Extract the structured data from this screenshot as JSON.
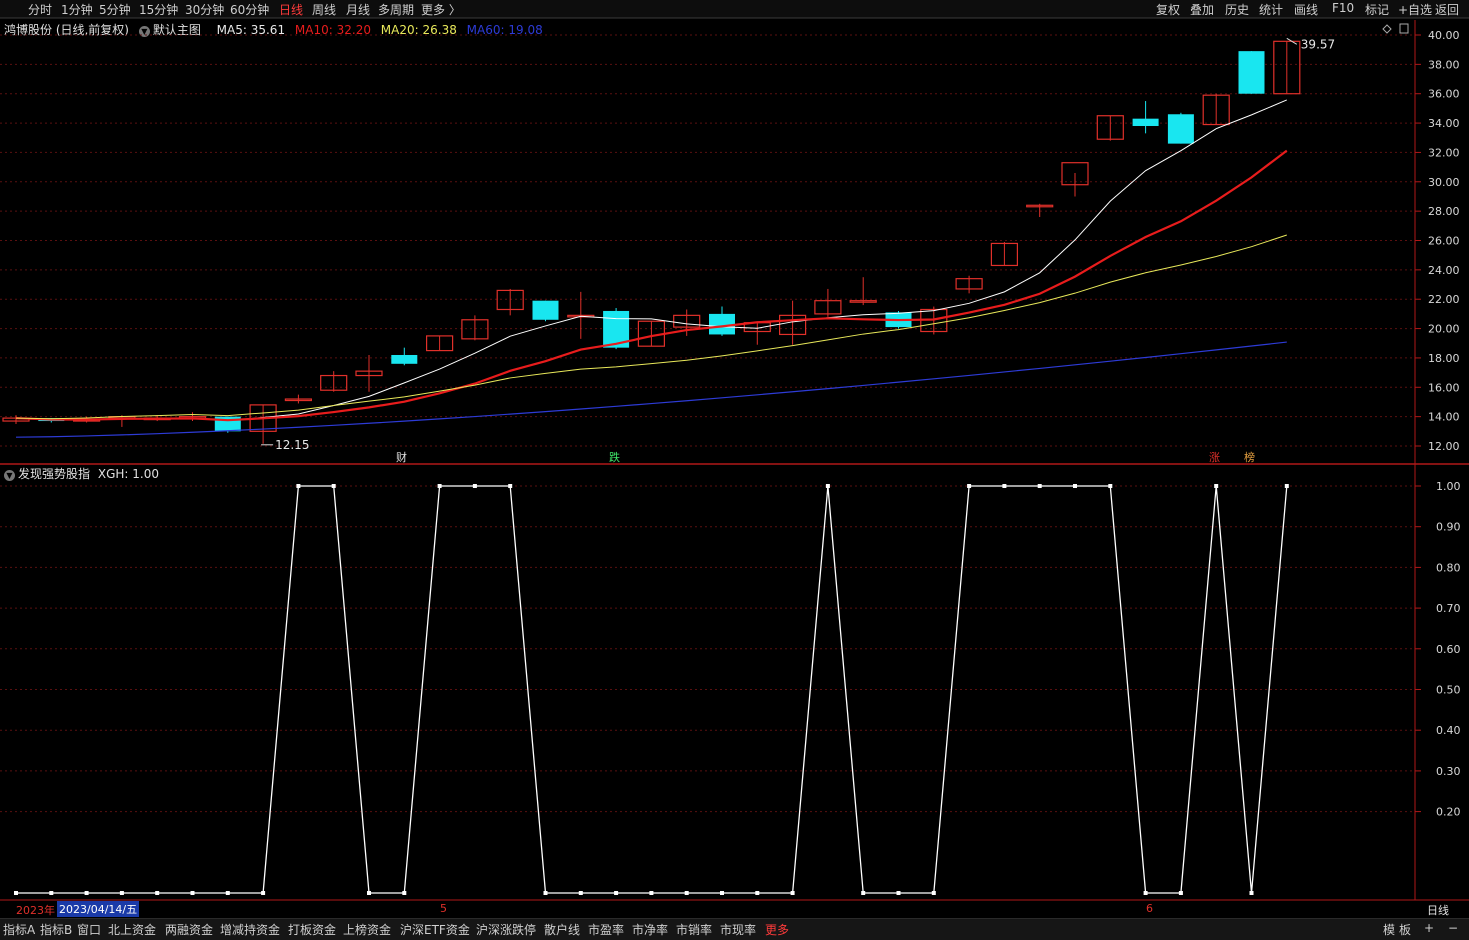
{
  "toolbar": {
    "left_items": [
      "分时",
      "1分钟",
      "5分钟",
      "15分钟",
      "30分钟",
      "60分钟",
      "日线",
      "周线",
      "月线",
      "多周期",
      "更多 〉"
    ],
    "active": "日线",
    "right_items": [
      "复权",
      "叠加",
      "历史",
      "统计",
      "画线",
      "F10",
      "标记",
      "+自选",
      "返回"
    ]
  },
  "main": {
    "stock": "鸿博股份 (日线,前复权)",
    "theme": "默认主图",
    "ma5": "MA5: 35.61",
    "ma10": "MA10: 32.20",
    "ma20": "MA20: 26.38",
    "ma60": "MA60: 19.08",
    "high_label": "39.57",
    "low_label": "12.15",
    "markers": [
      "财",
      "跌",
      "涨",
      "榜"
    ],
    "yticks": [
      "40.00",
      "38.00",
      "36.00",
      "34.00",
      "32.00",
      "30.00",
      "28.00",
      "26.00",
      "24.00",
      "22.00",
      "20.00",
      "18.00",
      "16.00",
      "14.00",
      "12.00"
    ],
    "colors": {
      "up": "#e0302a",
      "down": "#19e6f0",
      "ma5": "#ffffff",
      "ma10": "#e81c1c",
      "ma20": "#e8e85a",
      "ma60": "#2d3bd6",
      "grid": "#5a1010"
    }
  },
  "indicator": {
    "title": "发现强势股指",
    "value": "XGH: 1.00",
    "yticks": [
      "1.00",
      "0.90",
      "0.80",
      "0.70",
      "0.60",
      "0.50",
      "0.40",
      "0.30",
      "0.20"
    ]
  },
  "xaxis": {
    "year": "2023年",
    "cursor_date": "2023/04/14/五",
    "m5": "5",
    "m6": "6",
    "period": "日线"
  },
  "tabs": [
    "指标A",
    "指标B",
    "窗口",
    "北上资金",
    "两融资金",
    "增减持资金",
    "打板资金",
    "上榜资金",
    "沪深ETF资金",
    "沪深涨跌停",
    "散户线",
    "市盈率",
    "市净率",
    "市销率",
    "市现率",
    "更多"
  ],
  "right_controls": [
    "模",
    "板",
    "+",
    "−"
  ],
  "chart_data": {
    "type": "candlestick",
    "ohlc": [
      [
        13.7,
        14.1,
        13.5,
        13.9
      ],
      [
        13.9,
        13.9,
        13.6,
        13.7
      ],
      [
        13.8,
        14.0,
        13.6,
        13.8
      ],
      [
        13.9,
        14.1,
        13.3,
        14.0
      ],
      [
        13.8,
        14.1,
        13.7,
        13.9
      ],
      [
        13.9,
        14.3,
        13.7,
        14.0
      ],
      [
        14.0,
        14.0,
        12.9,
        13.0
      ],
      [
        13.0,
        14.8,
        12.15,
        14.8
      ],
      [
        15.1,
        15.5,
        14.9,
        15.2
      ],
      [
        15.8,
        17.1,
        15.7,
        16.8
      ],
      [
        16.8,
        18.2,
        15.7,
        17.1
      ],
      [
        18.2,
        18.7,
        17.5,
        17.6
      ],
      [
        18.5,
        19.5,
        18.5,
        19.5
      ],
      [
        19.3,
        20.9,
        19.2,
        20.6
      ],
      [
        21.3,
        22.7,
        20.9,
        22.6
      ],
      [
        21.9,
        21.9,
        20.5,
        20.6
      ],
      [
        20.9,
        22.5,
        19.3,
        20.9
      ],
      [
        21.2,
        21.4,
        18.6,
        18.7
      ],
      [
        18.8,
        20.5,
        18.8,
        20.5
      ],
      [
        20.1,
        21.3,
        19.5,
        20.9
      ],
      [
        21.0,
        21.5,
        19.5,
        19.6
      ],
      [
        19.8,
        20.4,
        18.9,
        20.4
      ],
      [
        19.6,
        21.9,
        18.9,
        20.9
      ],
      [
        21.0,
        22.7,
        20.8,
        21.9
      ],
      [
        21.9,
        23.5,
        21.6,
        21.9
      ],
      [
        21.1,
        21.2,
        20.0,
        20.1
      ],
      [
        19.8,
        21.5,
        19.6,
        21.3
      ],
      [
        22.7,
        23.6,
        22.4,
        23.4
      ],
      [
        24.3,
        25.9,
        24.3,
        25.8
      ],
      [
        28.3,
        28.5,
        27.6,
        28.4
      ],
      [
        29.8,
        30.6,
        29.0,
        31.3
      ],
      [
        32.9,
        34.5,
        32.8,
        34.5
      ],
      [
        34.3,
        35.5,
        33.3,
        33.8
      ],
      [
        34.6,
        34.7,
        32.6,
        32.6
      ],
      [
        33.9,
        36.0,
        33.9,
        35.9
      ],
      [
        38.9,
        38.9,
        36.0,
        36.0
      ],
      [
        36.0,
        39.57,
        36.0,
        39.57
      ]
    ],
    "indicator": "XGH",
    "xgh": [
      0,
      0,
      0,
      0,
      0,
      0,
      0,
      0,
      1,
      1,
      0,
      0,
      1,
      1,
      1,
      0,
      0,
      0,
      0,
      0,
      0,
      0,
      0,
      1,
      0,
      0,
      0,
      1,
      1,
      1,
      1,
      1,
      0,
      0,
      1,
      0,
      1
    ],
    "ylim": [
      11.5,
      40.3
    ]
  }
}
